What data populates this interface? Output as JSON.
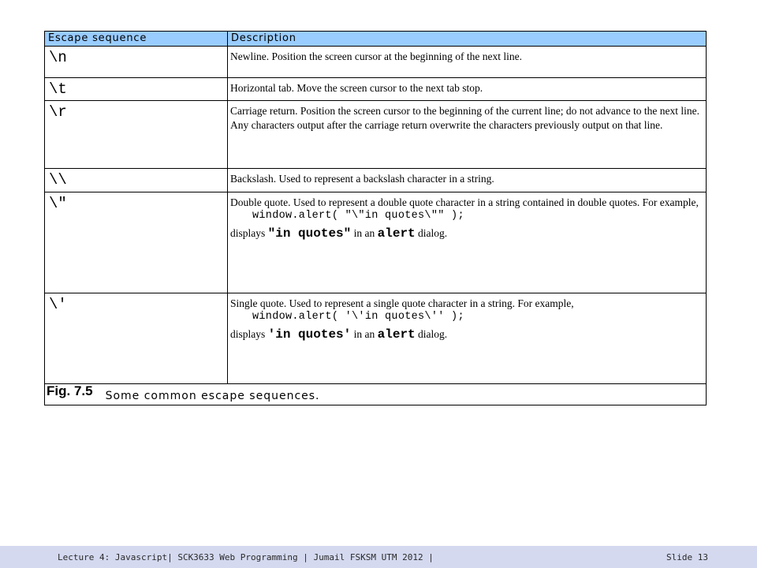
{
  "table": {
    "headers": [
      "Escape sequence",
      "Description"
    ],
    "rows": [
      {
        "seq": "\\n",
        "desc": "Newline. Position the screen cursor at the beginning of the next line."
      },
      {
        "seq": "\\t",
        "desc": "Horizontal tab. Move the screen cursor to the next tab stop."
      },
      {
        "seq": "\\r",
        "desc": "Carriage return. Position the screen cursor to the beginning of the current line; do not advance to the next line. Any characters output after the carriage return overwrite the characters previously output on that line."
      },
      {
        "seq": "\\\\",
        "desc": "Backslash. Used to represent a backslash character in a string."
      },
      {
        "seq": "\\\"",
        "desc": "Double quote. Used to represent a double quote character in a string contained in double quotes. For example,",
        "code": "window.alert( \"\\\"in quotes\\\"\" );",
        "display_prefix": "displays",
        "display_value": "\"in quotes\"",
        "display_mid": "in an",
        "display_alert": "alert",
        "display_suffix": "dialog."
      },
      {
        "seq": "\\'",
        "desc": "Single quote. Used to represent a single quote character in a string. For example,",
        "code": "window.alert( '\\'in quotes\\'' );",
        "display_prefix": "displays",
        "display_value": "'in quotes'",
        "display_mid": "in an",
        "display_alert": "alert",
        "display_suffix": "dialog."
      }
    ],
    "caption_number": "Fig. 7.5",
    "caption_text": "Some common escape sequences."
  },
  "footer": {
    "left": "Lecture 4: Javascript| SCK3633 Web Programming | Jumail FSKSM UTM 2012 |",
    "right": "Slide 13"
  },
  "colors": {
    "header_bg": "#99ccff",
    "footer_bg": "#d4d9f0"
  }
}
